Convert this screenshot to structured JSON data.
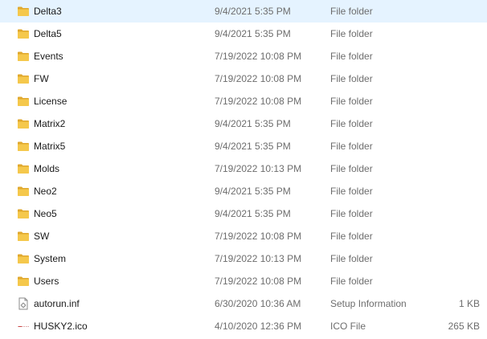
{
  "files": [
    {
      "name": "Delta3",
      "date": "9/4/2021 5:35 PM",
      "type": "File folder",
      "size": "",
      "icon": "folder-icon"
    },
    {
      "name": "Delta5",
      "date": "9/4/2021 5:35 PM",
      "type": "File folder",
      "size": "",
      "icon": "folder-icon"
    },
    {
      "name": "Events",
      "date": "7/19/2022 10:08 PM",
      "type": "File folder",
      "size": "",
      "icon": "folder-icon"
    },
    {
      "name": "FW",
      "date": "7/19/2022 10:08 PM",
      "type": "File folder",
      "size": "",
      "icon": "folder-icon"
    },
    {
      "name": "License",
      "date": "7/19/2022 10:08 PM",
      "type": "File folder",
      "size": "",
      "icon": "folder-icon"
    },
    {
      "name": "Matrix2",
      "date": "9/4/2021 5:35 PM",
      "type": "File folder",
      "size": "",
      "icon": "folder-icon"
    },
    {
      "name": "Matrix5",
      "date": "9/4/2021 5:35 PM",
      "type": "File folder",
      "size": "",
      "icon": "folder-icon"
    },
    {
      "name": "Molds",
      "date": "7/19/2022 10:13 PM",
      "type": "File folder",
      "size": "",
      "icon": "folder-icon"
    },
    {
      "name": "Neo2",
      "date": "9/4/2021 5:35 PM",
      "type": "File folder",
      "size": "",
      "icon": "folder-icon"
    },
    {
      "name": "Neo5",
      "date": "9/4/2021 5:35 PM",
      "type": "File folder",
      "size": "",
      "icon": "folder-icon"
    },
    {
      "name": "SW",
      "date": "7/19/2022 10:08 PM",
      "type": "File folder",
      "size": "",
      "icon": "folder-icon"
    },
    {
      "name": "System",
      "date": "7/19/2022 10:13 PM",
      "type": "File folder",
      "size": "",
      "icon": "folder-icon"
    },
    {
      "name": "Users",
      "date": "7/19/2022 10:08 PM",
      "type": "File folder",
      "size": "",
      "icon": "folder-icon"
    },
    {
      "name": "autorun.inf",
      "date": "6/30/2020 10:36 AM",
      "type": "Setup Information",
      "size": "1 KB",
      "icon": "setup-file-icon"
    },
    {
      "name": "HUSKY2.ico",
      "date": "4/10/2020 12:36 PM",
      "type": "ICO File",
      "size": "265 KB",
      "icon": "ico-file-icon"
    }
  ],
  "colors": {
    "folder": "#f5c84c",
    "folder_dark": "#e0a82e",
    "text": "#1a1a1a",
    "meta_text": "#6d6d6d",
    "hover": "#e5f3ff"
  }
}
